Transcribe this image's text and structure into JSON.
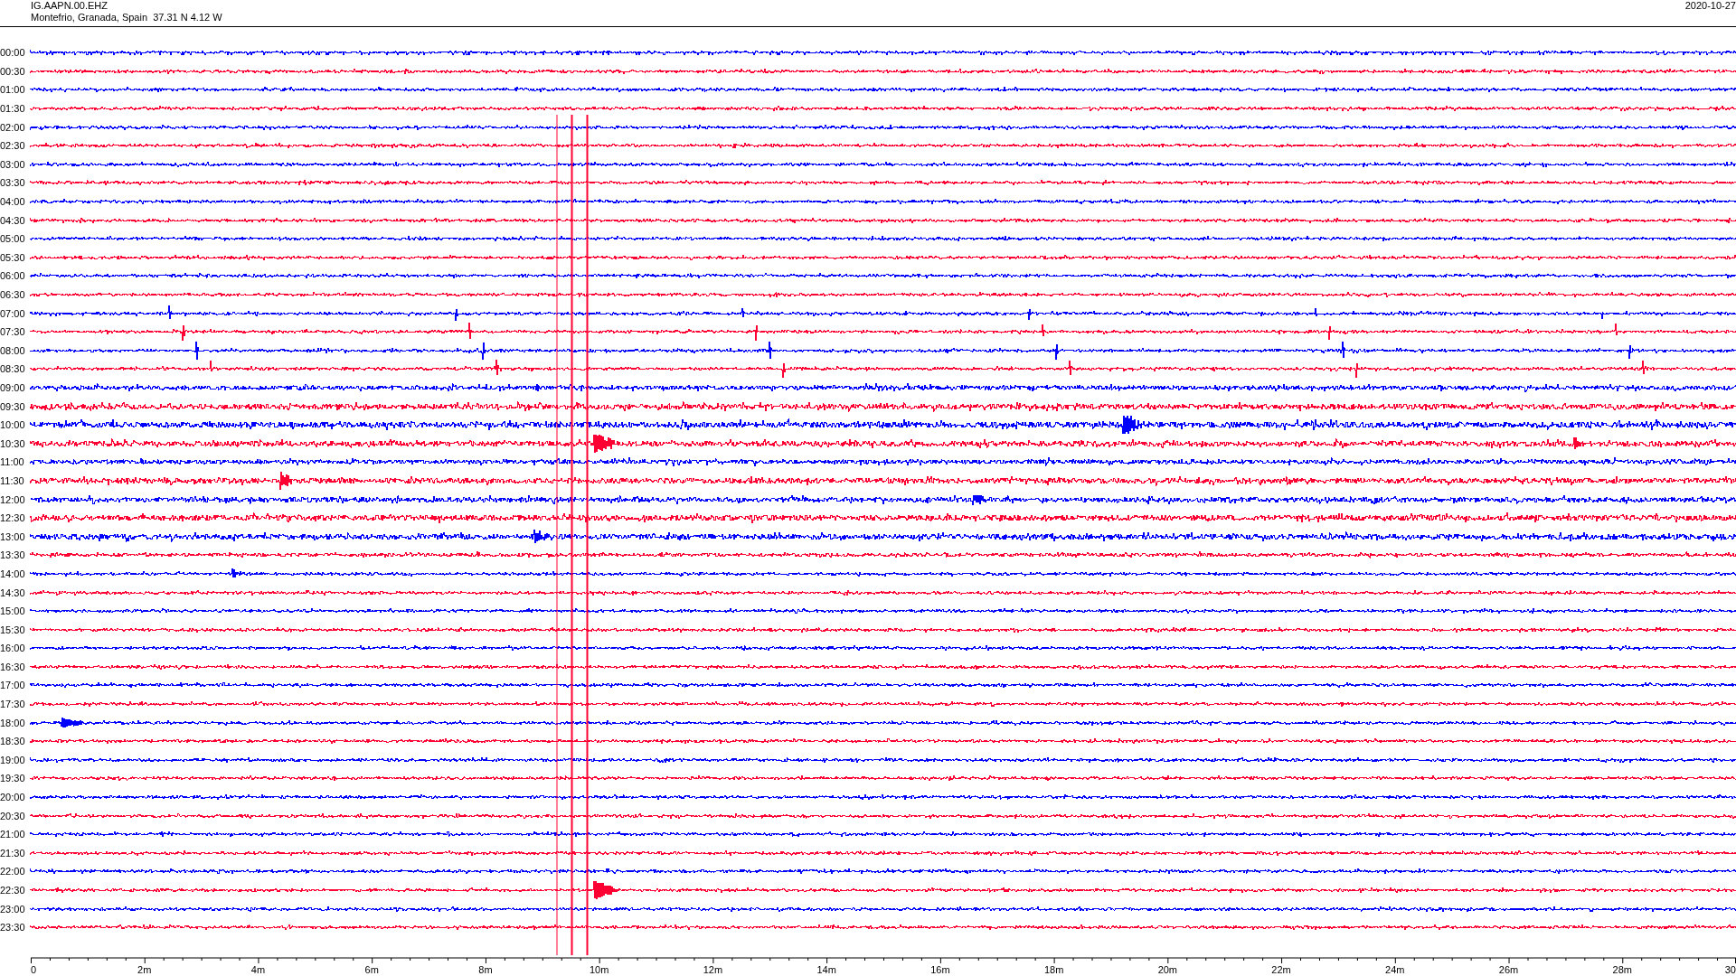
{
  "header": {
    "station": "IG.AAPN.00.EHZ",
    "location": "Montefrio, Granada, Spain  37.31 N 4.12 W",
    "date": "2020-10-27"
  },
  "rows": [
    {
      "time": "00:00",
      "color": "#0000ff"
    },
    {
      "time": "00:30",
      "color": "#ff0033"
    },
    {
      "time": "01:00",
      "color": "#0000ff"
    },
    {
      "time": "01:30",
      "color": "#ff0033"
    },
    {
      "time": "02:00",
      "color": "#0000ff"
    },
    {
      "time": "02:30",
      "color": "#ff0033"
    },
    {
      "time": "03:00",
      "color": "#0000ff"
    },
    {
      "time": "03:30",
      "color": "#ff0033"
    },
    {
      "time": "04:00",
      "color": "#0000ff"
    },
    {
      "time": "04:30",
      "color": "#ff0033"
    },
    {
      "time": "05:00",
      "color": "#0000ff"
    },
    {
      "time": "05:30",
      "color": "#ff0033"
    },
    {
      "time": "06:00",
      "color": "#0000ff"
    },
    {
      "time": "06:30",
      "color": "#ff0033"
    },
    {
      "time": "07:00",
      "color": "#0000ff"
    },
    {
      "time": "07:30",
      "color": "#ff0033"
    },
    {
      "time": "08:00",
      "color": "#0000ff"
    },
    {
      "time": "08:30",
      "color": "#ff0033"
    },
    {
      "time": "09:00",
      "color": "#0000ff"
    },
    {
      "time": "09:30",
      "color": "#ff0033"
    },
    {
      "time": "10:00",
      "color": "#0000ff"
    },
    {
      "time": "10:30",
      "color": "#ff0033"
    },
    {
      "time": "11:00",
      "color": "#0000ff"
    },
    {
      "time": "11:30",
      "color": "#ff0033"
    },
    {
      "time": "12:00",
      "color": "#0000ff"
    },
    {
      "time": "12:30",
      "color": "#ff0033"
    },
    {
      "time": "13:00",
      "color": "#0000ff"
    },
    {
      "time": "13:30",
      "color": "#ff0033"
    },
    {
      "time": "14:00",
      "color": "#0000ff"
    },
    {
      "time": "14:30",
      "color": "#ff0033"
    },
    {
      "time": "15:00",
      "color": "#0000ff"
    },
    {
      "time": "15:30",
      "color": "#ff0033"
    },
    {
      "time": "16:00",
      "color": "#0000ff"
    },
    {
      "time": "16:30",
      "color": "#ff0033"
    },
    {
      "time": "17:00",
      "color": "#0000ff"
    },
    {
      "time": "17:30",
      "color": "#ff0033"
    },
    {
      "time": "18:00",
      "color": "#0000ff"
    },
    {
      "time": "18:30",
      "color": "#ff0033"
    },
    {
      "time": "19:00",
      "color": "#0000ff"
    },
    {
      "time": "19:30",
      "color": "#ff0033"
    },
    {
      "time": "20:00",
      "color": "#0000ff"
    },
    {
      "time": "20:30",
      "color": "#ff0033"
    },
    {
      "time": "21:00",
      "color": "#0000ff"
    },
    {
      "time": "21:30",
      "color": "#ff0033"
    },
    {
      "time": "22:00",
      "color": "#0000ff"
    },
    {
      "time": "22:30",
      "color": "#ff0033"
    },
    {
      "time": "23:00",
      "color": "#0000ff"
    },
    {
      "time": "23:30",
      "color": "#ff0033"
    }
  ],
  "axis": {
    "ticks": [
      "0",
      "2m",
      "4m",
      "6m",
      "8m",
      "10m",
      "12m",
      "14m",
      "16m",
      "18m",
      "20m",
      "22m",
      "24m",
      "26m",
      "28m",
      "30"
    ]
  }
}
